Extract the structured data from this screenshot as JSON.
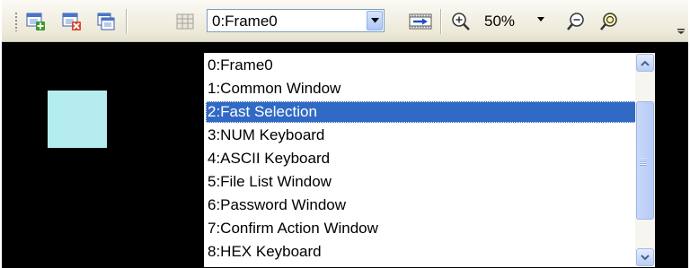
{
  "toolbar": {
    "frame_select": {
      "value": "0:Frame0",
      "options": [
        "0:Frame0",
        "1:Common Window",
        "2:Fast Selection",
        "3:NUM Keyboard",
        "4:ASCII Keyboard",
        "5:File List Window",
        "6:Password Window",
        "7:Confirm Action Window",
        "8:HEX Keyboard"
      ],
      "highlighted": "2:Fast Selection"
    },
    "zoom_level": "50%"
  },
  "icons": {
    "new_frame": "add-frame-icon",
    "delete_frame": "delete-frame-icon",
    "copy_frame": "copy-frame-icon",
    "frame_list": "frame-list-icon",
    "goto_frame": "goto-frame-icon",
    "zoom_in": "zoom-in-icon",
    "zoom_out": "zoom-out-icon",
    "zoom_fit": "zoom-fit-icon"
  },
  "colors": {
    "canvas_background": "#000000",
    "frame_rect_fill": "#b5ecef",
    "selection_highlight": "#316ac5"
  }
}
